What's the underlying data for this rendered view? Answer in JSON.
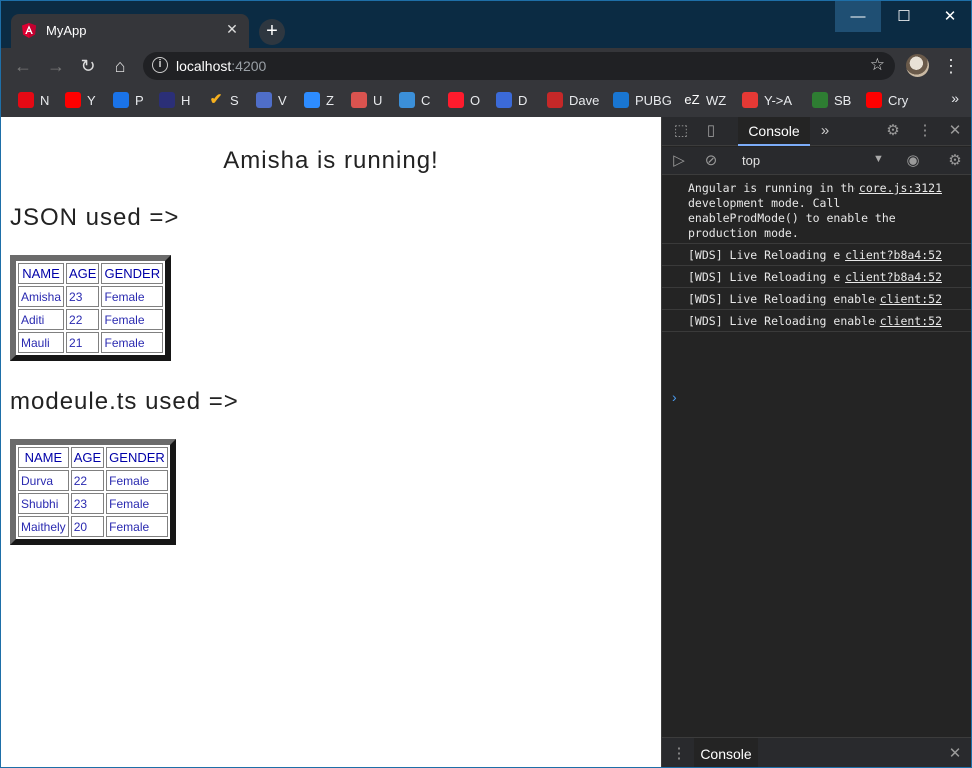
{
  "browser": {
    "tab_title": "MyApp",
    "url_host": "localhost",
    "url_port": ":4200",
    "accent": "#dd0031"
  },
  "bookmarks": [
    {
      "label": "N",
      "icon": "netflix-icon",
      "color": "#e50914"
    },
    {
      "label": "Y",
      "icon": "youtube-icon",
      "color": "#ff0000"
    },
    {
      "label": "P",
      "icon": "play-icon",
      "color": "#1a73e8"
    },
    {
      "label": "H",
      "icon": "hindi-icon",
      "color": "#2b2f77"
    },
    {
      "label": "S",
      "icon": "check-icon",
      "color": "#f6b01e"
    },
    {
      "label": "V",
      "icon": "vault-icon",
      "color": "#4f6ec9"
    },
    {
      "label": "Z",
      "icon": "zoom-icon",
      "color": "#2d8cff"
    },
    {
      "label": "U",
      "icon": "udemy-icon",
      "color": "#d9534f"
    },
    {
      "label": "C",
      "icon": "infinity-icon",
      "color": "#3b8fd8"
    },
    {
      "label": "O",
      "icon": "opera-icon",
      "color": "#ff1b2d"
    },
    {
      "label": "D",
      "icon": "glasses-icon",
      "color": "#3b6ad8"
    },
    {
      "label": "Dave",
      "icon": "save-icon",
      "color": "#c62828"
    },
    {
      "label": "PUBG",
      "icon": "e-icon",
      "color": "#1976d2"
    },
    {
      "label": "WZ",
      "icon": "ez-icon",
      "color": "#ffffff"
    },
    {
      "label": "Y->A",
      "icon": "convert-icon",
      "color": "#e53935"
    },
    {
      "label": "SB",
      "icon": "circle-icon",
      "color": "#2e7d32"
    },
    {
      "label": "Cry",
      "icon": "youtube-icon",
      "color": "#ff0000"
    }
  ],
  "page": {
    "title": "Amisha is running!",
    "section1_heading": "JSON used =>",
    "section2_heading": "modeule.ts used =>",
    "table_headers": [
      "NAME",
      "AGE",
      "GENDER"
    ],
    "table1_rows": [
      [
        "Amisha",
        "23",
        "Female"
      ],
      [
        "Aditi",
        "22",
        "Female"
      ],
      [
        "Mauli",
        "21",
        "Female"
      ]
    ],
    "table2_rows": [
      [
        "Durva",
        "22",
        "Female"
      ],
      [
        "Shubhi",
        "23",
        "Female"
      ],
      [
        "Maithely",
        "20",
        "Female"
      ]
    ]
  },
  "devtools": {
    "tab_console": "Console",
    "context": "top",
    "drawer_tab": "Console",
    "messages": [
      {
        "text": "Angular is running in the development mode. Call enableProdMode() to enable the production mode.",
        "source": "core.js:3121"
      },
      {
        "text": "[WDS] Live Reloading enabled.",
        "source": "client?b8a4:52"
      },
      {
        "text": "[WDS] Live Reloading enabled.",
        "source": "client?b8a4:52"
      },
      {
        "text": "[WDS] Live Reloading enabled.",
        "source": "client:52"
      },
      {
        "text": "[WDS] Live Reloading enabled.",
        "source": "client:52"
      }
    ],
    "prompt_symbol": "›"
  }
}
